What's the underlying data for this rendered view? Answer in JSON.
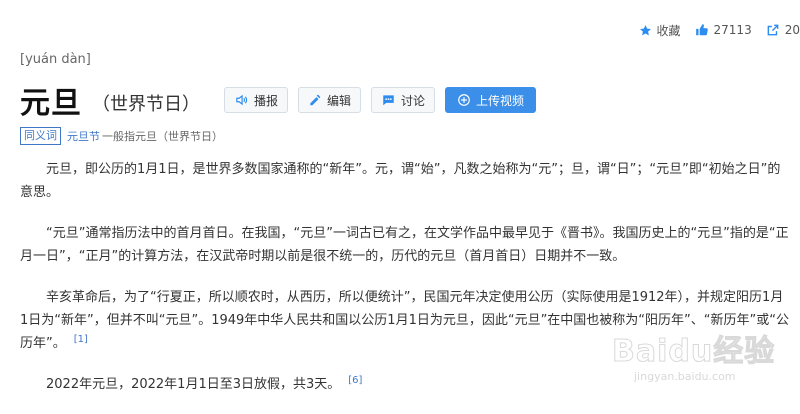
{
  "header": {
    "collect_label": "收藏",
    "like_count": "27113",
    "share_count": "20"
  },
  "entry": {
    "pinyin": "[yuán dàn]",
    "title": "元旦",
    "subtitle": "（世界节日）"
  },
  "actions": {
    "play_label": "播报",
    "edit_label": "编辑",
    "discuss_label": "讨论",
    "upload_label": "上传视频"
  },
  "synonym": {
    "tag": "同义词",
    "link": "元旦节",
    "note": "一般指元旦（世界节日）"
  },
  "paragraphs": [
    {
      "text": "元旦，即公历的1月1日，是世界多数国家通称的“新年”。元，谓“始”，凡数之始称为“元”；旦，谓“日”；“元旦”即“初始之日”的意思。",
      "ref": ""
    },
    {
      "text": "“元旦”通常指历法中的首月首日。在我国，“元旦”一词古已有之，在文学作品中最早见于《晋书》。我国历史上的“元旦”指的是“正月一日”，“正月”的计算方法，在汉武帝时期以前是很不统一的，历代的元旦（首月首日）日期并不一致。",
      "ref": ""
    },
    {
      "text": "辛亥革命后，为了“行夏正，所以顺农时，从西历，所以便统计”，民国元年决定使用公历（实际使用是1912年），并规定阳历1月1日为“新年”，但并不叫“元旦”。1949年中华人民共和国以公历1月1日为元旦，因此“元旦”在中国也被称为“阳历年”、“新历年”或“公历年”。",
      "ref": "[1]"
    },
    {
      "text": "2022年元旦，2022年1月1日至3日放假，共3天。",
      "ref": "[6]"
    }
  ],
  "watermark": {
    "logo": "Baidu经验",
    "url": "jingyan.baidu.com"
  },
  "colors": {
    "link": "#3f78c8",
    "primary_button": "#3b8fe8",
    "icon_blue": "#2d8cf0"
  }
}
